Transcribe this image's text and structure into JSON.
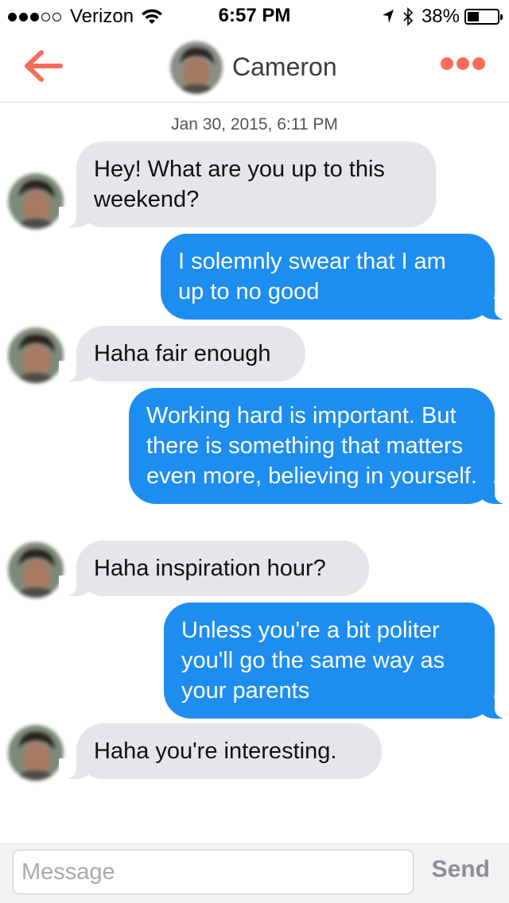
{
  "status_bar": {
    "carrier": "Verizon",
    "signal_bars_filled": 3,
    "signal_bars_total": 5,
    "time": "6:57 PM",
    "battery_percent": "38%",
    "battery_level": 0.38,
    "icons": [
      "wifi-icon",
      "location-arrow-icon",
      "bluetooth-icon",
      "battery-icon"
    ]
  },
  "header": {
    "back_icon": "back-arrow-icon",
    "title": "Cameron",
    "more_icon": "more-dots-icon",
    "accent_color": "#ff6b5a"
  },
  "conversation": {
    "timestamp": "Jan 30, 2015, 6:11 PM",
    "messages": [
      {
        "sender": "them",
        "text": "Hey! What are you up to this weekend?"
      },
      {
        "sender": "me",
        "text": "I solemnly swear that I am up to no good"
      },
      {
        "sender": "them",
        "text": "Haha fair enough"
      },
      {
        "sender": "me",
        "text": "Working hard is important. But there is something that matters even more, believing in yourself."
      },
      {
        "sender": "them",
        "text": "Haha inspiration hour?"
      },
      {
        "sender": "me",
        "text": "Unless you're a bit politer you'll go the same way as your parents"
      },
      {
        "sender": "them",
        "text": "Haha you're interesting."
      }
    ],
    "incoming_color": "#e5e5ea",
    "outgoing_color": "#1d8df0"
  },
  "composer": {
    "placeholder": "Message",
    "value": "",
    "send_label": "Send"
  }
}
